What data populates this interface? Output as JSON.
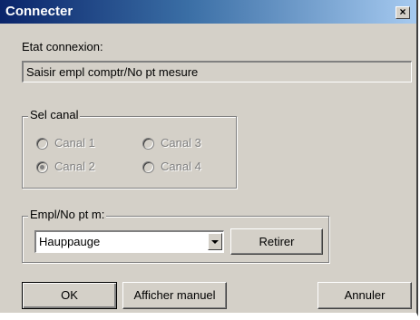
{
  "window": {
    "title": "Connecter",
    "close_label": "×"
  },
  "status": {
    "label": "Etat connexion:",
    "value": "Saisir empl comptr/No pt mesure"
  },
  "channel_group": {
    "legend": "Sel canal",
    "options": [
      {
        "label": "Canal 1",
        "checked": false,
        "enabled": false
      },
      {
        "label": "Canal 2",
        "checked": true,
        "enabled": false
      },
      {
        "label": "Canal 3",
        "checked": false,
        "enabled": false
      },
      {
        "label": "Canal 4",
        "checked": false,
        "enabled": false
      }
    ]
  },
  "location_group": {
    "legend": "Empl/No pt m:",
    "selected": "Hauppauge",
    "remove_label": "Retirer"
  },
  "buttons": {
    "ok": "OK",
    "manual": "Afficher manuel",
    "cancel": "Annuler"
  },
  "colors": {
    "titlebar_start": "#0a246a",
    "titlebar_end": "#a6caf0",
    "dialog_bg": "#d4d0c8",
    "disabled_text": "#808080"
  }
}
